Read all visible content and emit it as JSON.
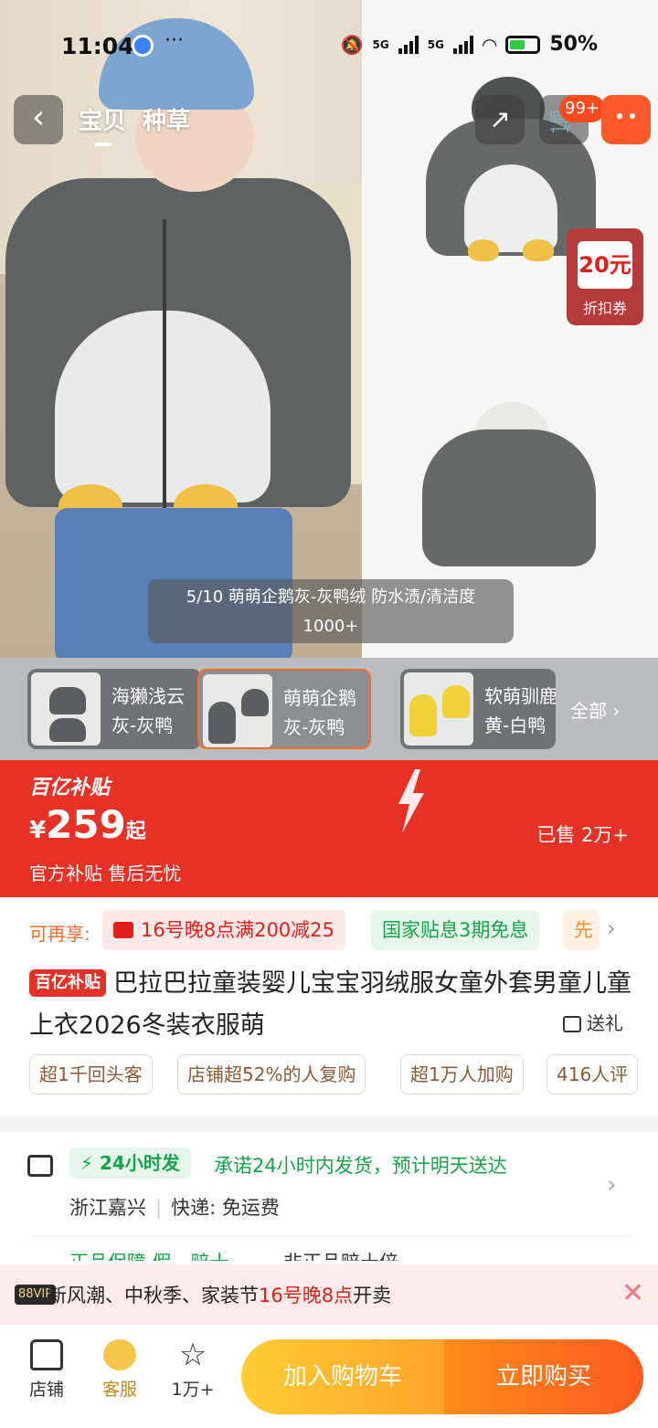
{
  "status_bar": {
    "time": "11:04",
    "dots": "···",
    "net1": "5G",
    "net2": "5G",
    "battery": "50%"
  },
  "nav": {
    "tabs": [
      "宝贝",
      "种草"
    ],
    "cart_badge": "99+"
  },
  "coupon_float": {
    "amount": "20元",
    "label": "折扣券"
  },
  "image_caption": {
    "line1": "5/10  萌萌企鹅灰-灰鸭绒 防水渍/清洁度",
    "line2": "1000+"
  },
  "skus": [
    {
      "line1": "海獭浅云",
      "line2": "灰-灰鸭"
    },
    {
      "line1": "萌萌企鹅",
      "line2": "灰-灰鸭"
    },
    {
      "line1": "软萌驯鹿",
      "line2": "黄-白鸭"
    }
  ],
  "sku_all": "全部",
  "price_band": {
    "logo": "百亿补贴",
    "currency": "¥",
    "price": "259",
    "suffix": "起",
    "sold": "已售 2万+",
    "tags": "官方补贴 售后无忧",
    "accent": "#e63127"
  },
  "promo": {
    "label": "可再享:",
    "chips": [
      "16号晚8点满200减25",
      "国家贴息3期免息",
      "先"
    ]
  },
  "product": {
    "badge": "百亿补贴",
    "title": "巴拉巴拉童装婴儿宝宝羽绒服女童外套男童儿童上衣2026冬装衣服萌",
    "gift": "送礼"
  },
  "features": [
    "超1千回头客",
    "店铺超52%的人复购",
    "超1万人加购",
    "416人评"
  ],
  "shipping": {
    "fast_tag": "24小时发",
    "promise": "承诺24小时内发货，预计明天送达",
    "origin": "浙江嘉兴",
    "courier": "快递: 免运费",
    "peek_green": "正品保障·假一赔十",
    "peek_dark": "非正品赔十倍"
  },
  "notice": {
    "vip": "88VIP",
    "text_a": "新风潮、中秋季、家装节",
    "text_hl": "16号晚8点",
    "text_b": "开卖"
  },
  "bottom_bar": {
    "shop": "店铺",
    "service": "客服",
    "fav": "1万+",
    "add_cart": "加入购物车",
    "buy_now": "立即购买"
  }
}
